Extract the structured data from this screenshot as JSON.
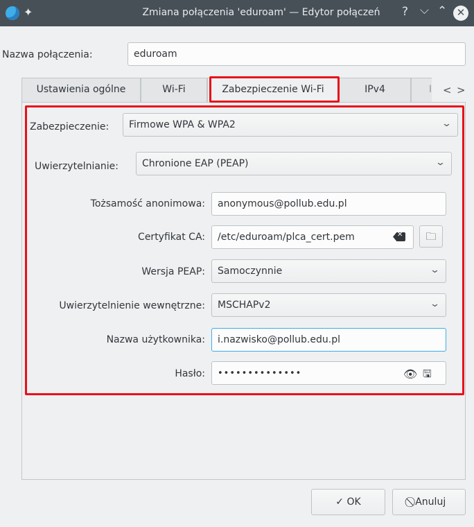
{
  "window": {
    "title": "Zmiana połączenia 'eduroam' — Edytor połączeń",
    "help": "?",
    "minimize": "⌵",
    "maximize": "⌃",
    "close": "✕"
  },
  "connection": {
    "name_label": "Nazwa połączenia:",
    "name_value": "eduroam"
  },
  "tabs": [
    {
      "label": "Ustawienia ogólne"
    },
    {
      "label": "Wi-Fi"
    },
    {
      "label": "Zabezpieczenie Wi-Fi",
      "active": true
    },
    {
      "label": "IPv4"
    },
    {
      "label": "I"
    }
  ],
  "tab_scroll": {
    "prev": "<",
    "next": ">"
  },
  "security": {
    "security_label": "Zabezpieczenie:",
    "security_value": "Firmowe WPA & WPA2",
    "auth_label": "Uwierzytelnianie:",
    "auth_value": "Chronione EAP (PEAP)",
    "anon_identity_label": "Tożsamość anonimowa:",
    "anon_identity_value": "anonymous@pollub.edu.pl",
    "ca_cert_label": "Certyfikat CA:",
    "ca_cert_value": "/etc/eduroam/plca_cert.pem",
    "peap_version_label": "Wersja PEAP:",
    "peap_version_value": "Samoczynnie",
    "inner_auth_label": "Uwierzytelnienie wewnętrzne:",
    "inner_auth_value": "MSCHAPv2",
    "username_label": "Nazwa użytkownika:",
    "username_value": "i.nazwisko@pollub.edu.pl",
    "password_label": "Hasło:",
    "password_value": "••••••••••••••"
  },
  "buttons": {
    "ok": "✓ OK",
    "cancel": "⃠ Anuluj"
  },
  "colors": {
    "highlight": "#e8101a",
    "focus": "#3daee9",
    "titlebar": "#475057"
  }
}
